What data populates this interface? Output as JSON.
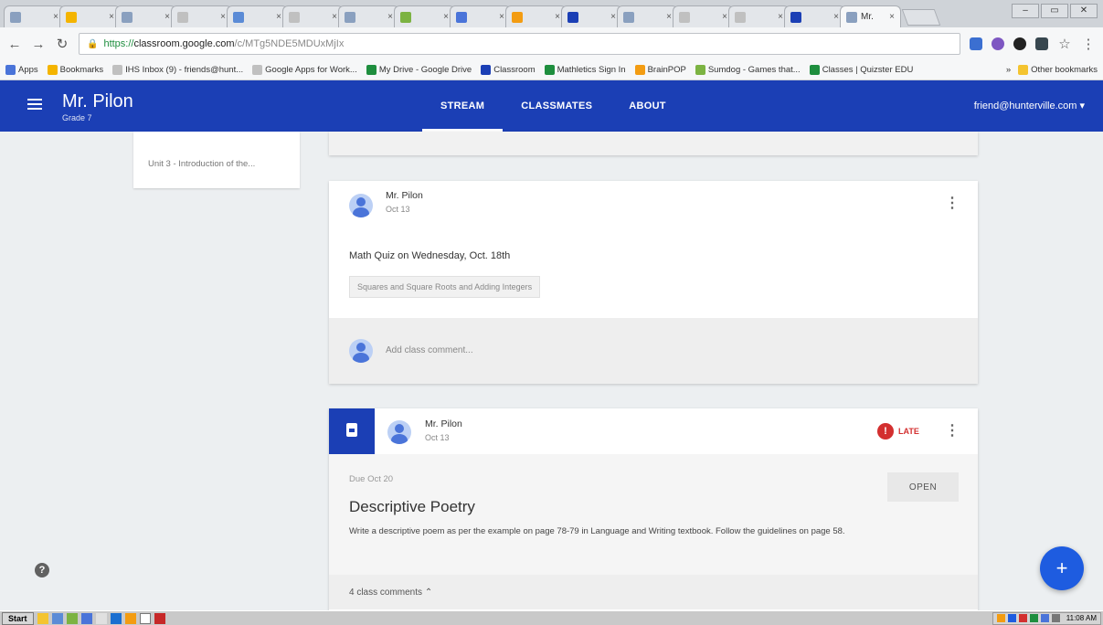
{
  "browser": {
    "tabs": [
      "",
      "",
      "",
      "",
      "",
      "",
      "",
      "",
      "",
      "",
      "",
      "",
      "",
      "",
      "",
      ""
    ],
    "active_tab_label": "Mr. ",
    "url": {
      "scheme": "https://",
      "host": "classroom.google.com",
      "path": "/c/MTg5NDE5MDUxMjIx"
    },
    "window_controls": [
      "–",
      "▭",
      "✕"
    ],
    "bookmarks": [
      {
        "label": "Apps",
        "color": "#4a74d9"
      },
      {
        "label": "Bookmarks",
        "color": "#f4b400"
      },
      {
        "label": "IHS Inbox (9) - friends@hunt...",
        "color": "#c0c0c0"
      },
      {
        "label": "Google Apps for Work...",
        "color": "#c0c0c0"
      },
      {
        "label": "My Drive - Google Drive",
        "color": "#1e8e3e"
      },
      {
        "label": "Classroom",
        "color": "#1b3fb5"
      },
      {
        "label": "Mathletics Sign In",
        "color": "#1e8e3e"
      },
      {
        "label": "BrainPOP",
        "color": "#f39c12"
      },
      {
        "label": "Sumdog - Games that...",
        "color": "#7cb342"
      },
      {
        "label": "Classes | Quizster EDU",
        "color": "#1e8e3e"
      }
    ],
    "other_bookmarks": "Other bookmarks"
  },
  "header": {
    "class_name": "Mr. Pilon",
    "section": "Grade 7",
    "tabs": [
      "STREAM",
      "CLASSMATES",
      "ABOUT"
    ],
    "active_tab": "STREAM",
    "user": "friend@hunterville.com ▾"
  },
  "sidebar": {
    "upcoming_item": "Unit 3 - Introduction of the..."
  },
  "stream": {
    "announcement": {
      "author": "Mr. Pilon",
      "date": "Oct 13",
      "text": "Math Quiz on Wednesday, Oct. 18th",
      "topic_chip": "Squares and Square Roots and Adding Integers",
      "comment_placeholder": "Add class comment..."
    },
    "assignment": {
      "author": "Mr. Pilon",
      "date": "Oct 13",
      "status": "LATE",
      "due": "Due Oct 20",
      "title": "Descriptive Poetry",
      "description": "Write a descriptive poem as per the example on page 78-79 in Language and Writing textbook. Follow the guidelines on page 58.",
      "open_label": "OPEN",
      "class_comments": "4 class comments"
    }
  },
  "taskbar": {
    "start_label": "Start",
    "clock": "11:08 AM"
  },
  "colors": {
    "brand": "#1b3fb5",
    "fab": "#1e5ce0",
    "late": "#d32f2f"
  }
}
